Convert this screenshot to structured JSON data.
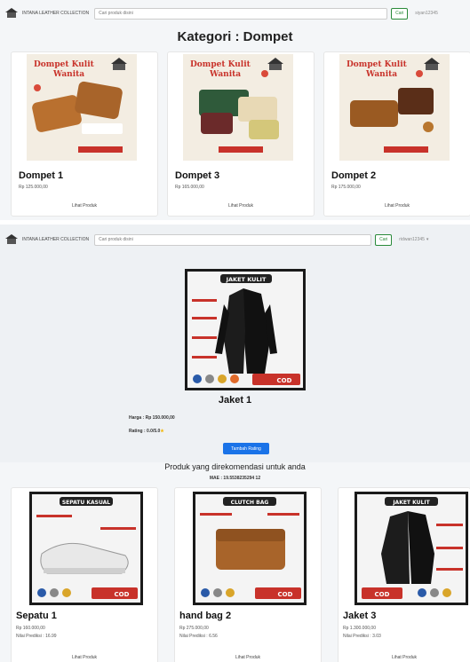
{
  "section1": {
    "nav": {
      "brand": "INTANA LEATHER COLLECTION",
      "search_placeholder": "Cari produk disini",
      "search_button": "Cari",
      "user": "siyan12345"
    },
    "page_title": "Kategori : Dompet",
    "products": [
      {
        "name": "Dompet 1",
        "price": "Rp 125.000,00",
        "link": "Lihat Produk",
        "poster_title": "Dompet Kulit Wanita"
      },
      {
        "name": "Dompet 3",
        "price": "Rp 165.000,00",
        "link": "Lihat Produk",
        "poster_title": "Dompet Kulit Wanita"
      },
      {
        "name": "Dompet 2",
        "price": "Rp 175.000,00",
        "link": "Lihat Produk",
        "poster_title": "Dompet Kulit Wanita"
      }
    ]
  },
  "section2": {
    "nav": {
      "brand": "INTANA LEATHER COLLECTION",
      "search_placeholder": "Cari produk disini",
      "search_button": "Cari",
      "user": "ridwan12345"
    },
    "product": {
      "name": "Jaket 1",
      "price_label": "Harga : Rp 150.000,00",
      "rating_label": "Rating : 0.0/5.0",
      "poster_title": "JAKET KULIT",
      "badge": "COD"
    },
    "rating_button": "Tambah Rating"
  },
  "section3": {
    "heading": "Produk yang direkomendasi untuk anda",
    "mae": "MAE : 19.5538235294 12",
    "products": [
      {
        "name": "Sepatu 1",
        "price": "Rp 160.000,00",
        "prediction": "Nilai Prediksi : 16.99",
        "link": "Lihat Produk",
        "poster_title": "SEPATU KASUAL",
        "badge": "COD"
      },
      {
        "name": "hand bag 2",
        "price": "Rp 275.000,00",
        "prediction": "Nilai Prediksi : 6.56",
        "link": "Lihat Produk",
        "poster_title": "CLUTCH BAG",
        "badge": "COD"
      },
      {
        "name": "Jaket 3",
        "price": "Rp 1.300.000,00",
        "prediction": "Nilai Prediksi : 3.03",
        "link": "Lihat Produk",
        "poster_title": "JAKET KULIT",
        "badge": "COD"
      }
    ]
  },
  "colors": {
    "accent": "#1a73e8",
    "brand_red": "#c8322a",
    "leather": "#a8642a",
    "success": "#2a8a3a"
  }
}
